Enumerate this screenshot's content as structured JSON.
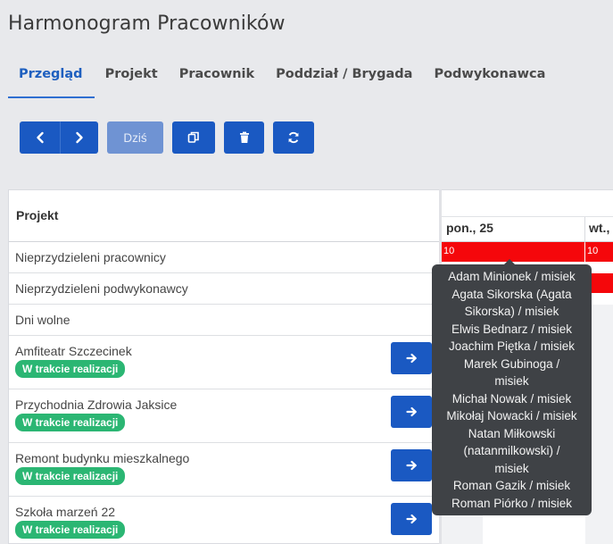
{
  "page": {
    "title": "Harmonogram Pracowników"
  },
  "tabs": [
    {
      "label": "Przegląd",
      "active": true
    },
    {
      "label": "Projekt",
      "active": false
    },
    {
      "label": "Pracownik",
      "active": false
    },
    {
      "label": "Poddział / Brygada",
      "active": false
    },
    {
      "label": "Podwykonawca",
      "active": false
    }
  ],
  "toolbar": {
    "prev_icon": "chevron-left-icon",
    "next_icon": "chevron-right-icon",
    "today_label": "Dziś",
    "copy_icon": "copy-icon",
    "delete_icon": "trash-icon",
    "refresh_icon": "refresh-icon"
  },
  "table": {
    "header": "Projekt",
    "static_rows": [
      "Nieprzydzieleni pracownicy",
      "Nieprzydzieleni podwykonawcy",
      "Dni wolne"
    ],
    "projects": [
      {
        "name": "Amfiteatr Szczecinek",
        "status": "W trakcie realizacji"
      },
      {
        "name": "Przychodnia Zdrowia Jaksice",
        "status": "W trakcie realizacji"
      },
      {
        "name": "Remont budynku mieszkalnego",
        "status": "W trakcie realizacji"
      },
      {
        "name": "Szkoła marzeń 22",
        "status": "W trakcie realizacji"
      }
    ]
  },
  "calendar": {
    "days": [
      "pon., 25",
      "wt.,"
    ],
    "unassigned_counts": [
      "10",
      "10"
    ]
  },
  "tooltip": {
    "lines": [
      "Adam Minionek / misiek",
      "Agata Sikorska (Agata",
      "Sikorska) / misiek",
      "Elwis Bednarz / misiek",
      "Joachim Piętka / misiek",
      "Marek Gubinoga /",
      "misiek",
      "Michał Nowak / misiek",
      "Mikołaj Nowacki / misiek",
      "Natan Miłkowski",
      "(natanmilkowski) /",
      "misiek",
      "Roman Gazik / misiek",
      "Roman Piórko / misiek"
    ]
  },
  "colors": {
    "primary": "#1a59c2",
    "accent_tab": "#1e5fbf",
    "badge": "#2bb673",
    "alert": "#f5070b"
  }
}
